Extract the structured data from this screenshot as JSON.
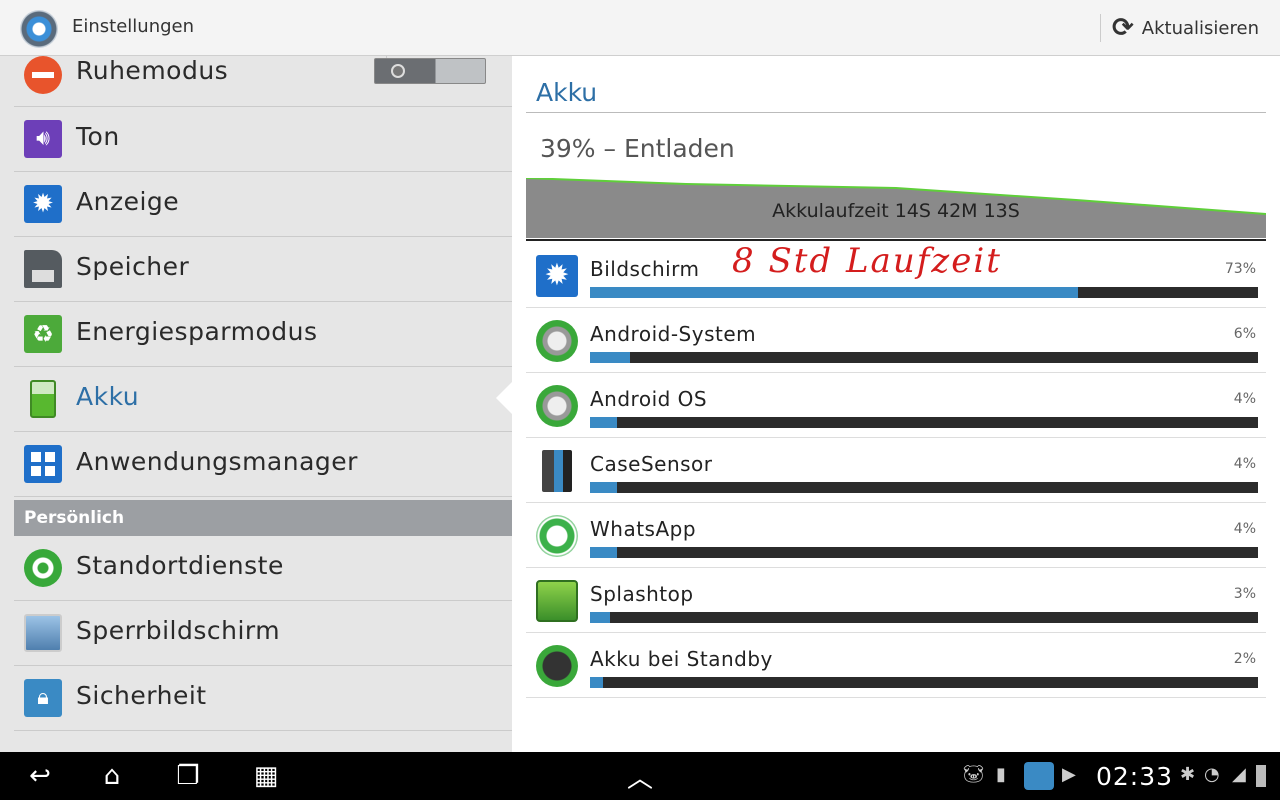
{
  "topbar": {
    "title": "Einstellungen",
    "refresh_label": "Aktualisieren"
  },
  "sidebar": {
    "items": [
      {
        "label": "Ruhemodus",
        "icon": "no-entry-icon",
        "color": "#e8542c"
      },
      {
        "label": "Ton",
        "icon": "speaker-icon",
        "color": "#6d3fb8"
      },
      {
        "label": "Anzeige",
        "icon": "brightness-icon",
        "color": "#1f6fc9"
      },
      {
        "label": "Speicher",
        "icon": "sd-card-icon",
        "color": "#555b60"
      },
      {
        "label": "Energiesparmodus",
        "icon": "recycle-icon",
        "color": "#4caa3a"
      },
      {
        "label": "Akku",
        "icon": "battery-icon",
        "color": "#58b82f"
      },
      {
        "label": "Anwendungsmanager",
        "icon": "apps-grid-icon",
        "color": "#1f6fc9"
      },
      {
        "label": "Standortdienste",
        "icon": "location-icon",
        "color": "#38a83a"
      },
      {
        "label": "Sperrbildschirm",
        "icon": "lock-screen-icon",
        "color": "#5a86b8"
      },
      {
        "label": "Sicherheit",
        "icon": "padlock-icon",
        "color": "#3a8ac4"
      }
    ],
    "section_label": "Persönlich"
  },
  "main": {
    "title": "Akku",
    "status": "39% – Entladen",
    "graph_label": "Akkulaufzeit 14S 42M 13S",
    "handwritten_note": "8 Std Laufzeit",
    "usage": [
      {
        "name": "Bildschirm",
        "percent": "73%",
        "value": 73,
        "icon": "brightness-icon"
      },
      {
        "name": "Android-System",
        "percent": "6%",
        "value": 6,
        "icon": "android-system-icon"
      },
      {
        "name": "Android OS",
        "percent": "4%",
        "value": 4,
        "icon": "android-os-icon"
      },
      {
        "name": "CaseSensor",
        "percent": "4%",
        "value": 4,
        "icon": "case-sensor-icon"
      },
      {
        "name": "WhatsApp",
        "percent": "4%",
        "value": 4,
        "icon": "whatsapp-icon"
      },
      {
        "name": "Splashtop",
        "percent": "3%",
        "value": 3,
        "icon": "splashtop-icon"
      },
      {
        "name": "Akku bei Standby",
        "percent": "2%",
        "value": 2,
        "icon": "standby-signal-icon"
      }
    ],
    "accent": "#2d6fa6",
    "bar_color": "#3a8ac4"
  },
  "navbar": {
    "clock": "02:33"
  }
}
